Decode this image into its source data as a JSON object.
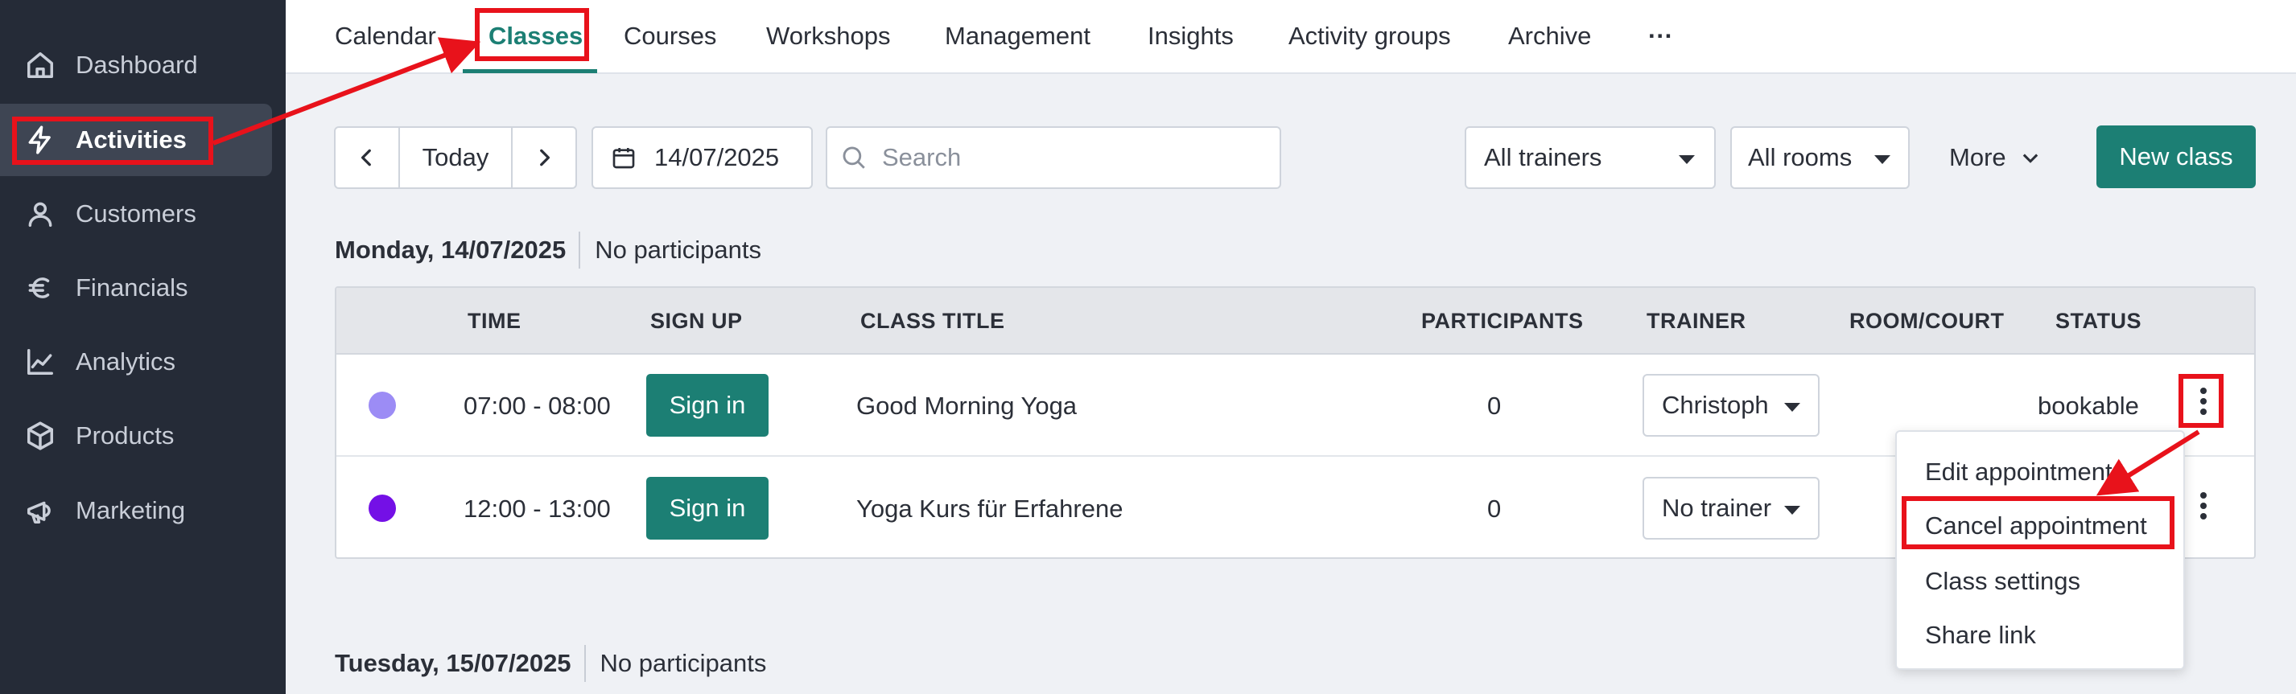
{
  "sidebar": {
    "items": [
      {
        "label": "Dashboard",
        "icon": "home-icon"
      },
      {
        "label": "Activities",
        "icon": "lightning-icon"
      },
      {
        "label": "Customers",
        "icon": "user-icon"
      },
      {
        "label": "Financials",
        "icon": "euro-icon"
      },
      {
        "label": "Analytics",
        "icon": "chart-line-icon"
      },
      {
        "label": "Products",
        "icon": "box-icon"
      },
      {
        "label": "Marketing",
        "icon": "megaphone-icon"
      }
    ],
    "active": "Activities"
  },
  "tabs": [
    "Calendar",
    "Classes",
    "Courses",
    "Workshops",
    "Management",
    "Insights",
    "Activity groups",
    "Archive",
    "···"
  ],
  "active_tab": "Classes",
  "toolbar": {
    "today_label": "Today",
    "date_value": "14/07/2025",
    "search_placeholder": "Search",
    "trainer_filter": "All trainers",
    "room_filter": "All rooms",
    "more_label": "More",
    "new_class_label": "New class"
  },
  "days": [
    {
      "date": "Monday, 14/07/2025",
      "participants": "No participants"
    },
    {
      "date": "Tuesday, 15/07/2025",
      "participants": "No participants"
    }
  ],
  "table": {
    "columns": [
      "TIME",
      "SIGN UP",
      "CLASS TITLE",
      "PARTICIPANTS",
      "TRAINER",
      "ROOM/COURT",
      "STATUS"
    ],
    "rows": [
      {
        "color": "#9c8cf5",
        "time": "07:00 - 08:00",
        "signup": "Sign in",
        "title": "Good Morning Yoga",
        "participants": "0",
        "trainer": "Christoph",
        "room": "",
        "status": "bookable"
      },
      {
        "color": "#7410e6",
        "time": "12:00 - 13:00",
        "signup": "Sign in",
        "title": "Yoga Kurs für Erfahrene",
        "participants": "0",
        "trainer": "No trainer",
        "room": "",
        "status": ""
      }
    ]
  },
  "menu": {
    "items": [
      "Edit appointment",
      "Cancel appointment",
      "Class settings",
      "Share link"
    ]
  },
  "colors": {
    "accent": "#1c7f74",
    "sidebar_bg": "#252b37",
    "annotation": "#e8121b"
  }
}
